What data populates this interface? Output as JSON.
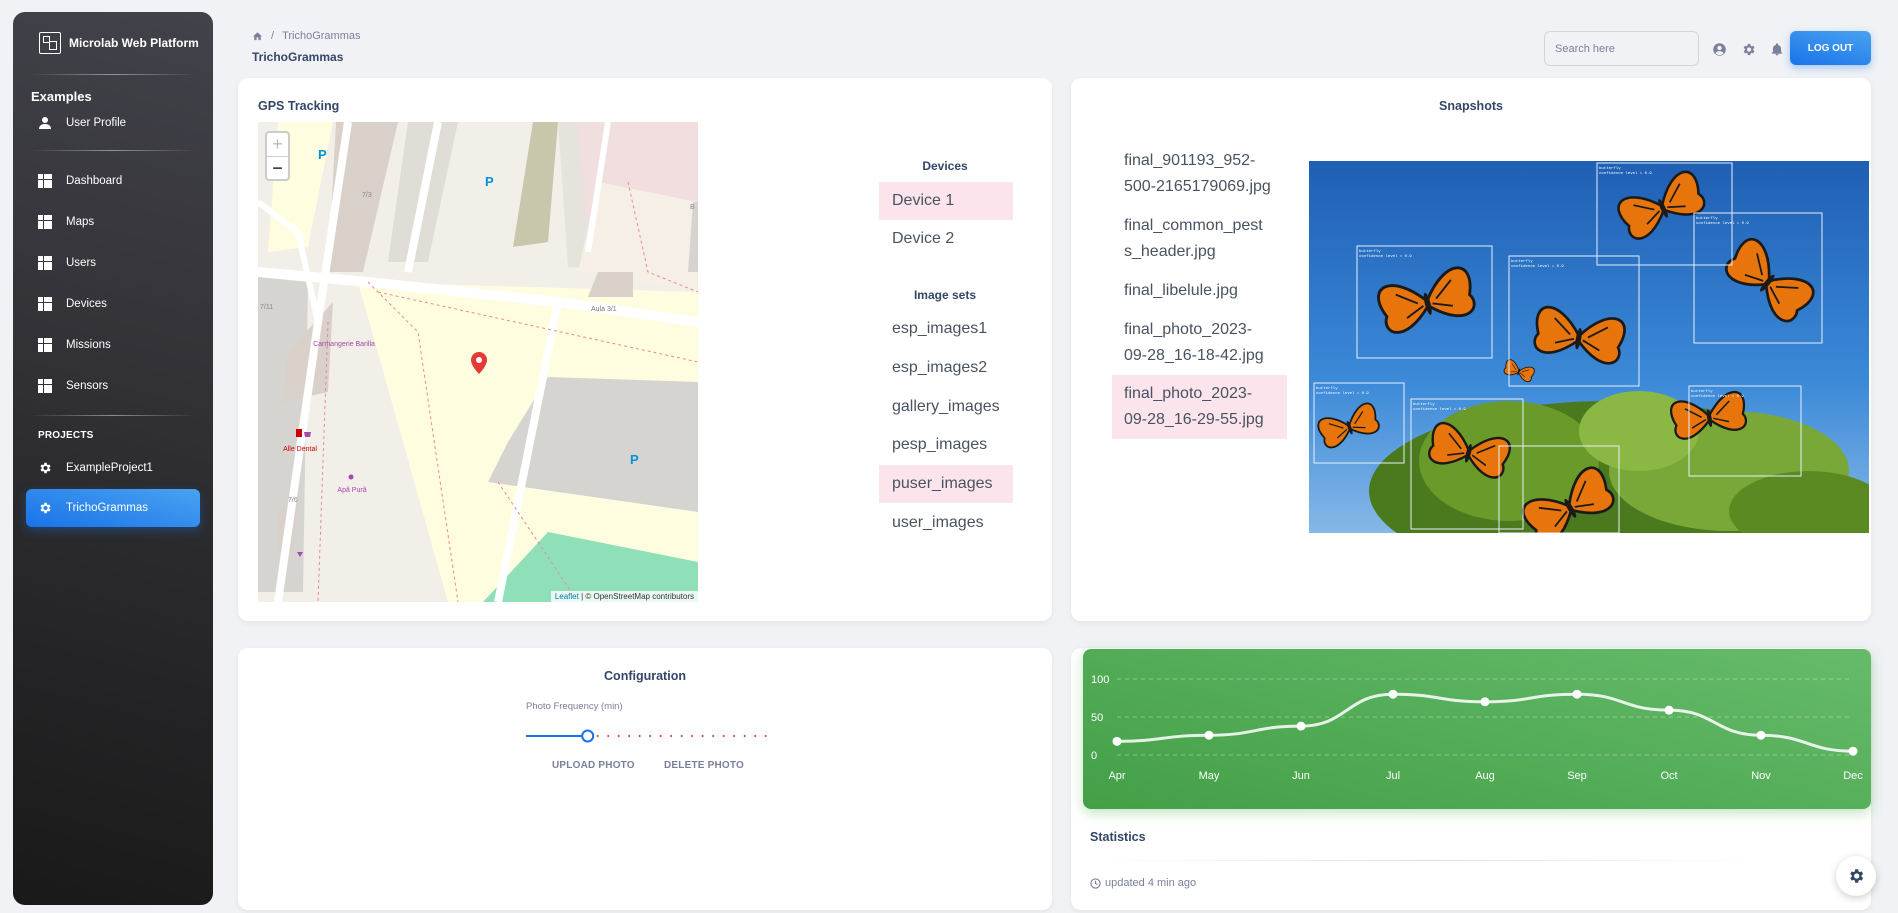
{
  "sidebar": {
    "brand": "Microlab Web Platform",
    "section_examples": "Examples",
    "user_profile": "User Profile",
    "nav": [
      {
        "label": "Dashboard"
      },
      {
        "label": "Maps"
      },
      {
        "label": "Users"
      },
      {
        "label": "Devices"
      },
      {
        "label": "Missions"
      },
      {
        "label": "Sensors"
      }
    ],
    "projects_heading": "PROJECTS",
    "projects": [
      {
        "label": "ExampleProject1",
        "active": false
      },
      {
        "label": "TrichoGrammas",
        "active": true
      }
    ]
  },
  "header": {
    "breadcrumb_current": "TrichoGrammas",
    "title": "TrichoGrammas",
    "search_placeholder": "Search here",
    "logout_label": "LOG OUT"
  },
  "gps": {
    "title": "GPS Tracking",
    "map_labels": {
      "p1": "P",
      "p2": "P",
      "p3": "P",
      "n73": "7/3",
      "n711": "7/11",
      "n76": "7/6",
      "b": "B",
      "aula": "Aula 3/1",
      "carmangerie": "Carmangerie Barilla",
      "dental": "Alle Dental",
      "apa": "Apă Pură"
    },
    "attribution_leaflet": "Leaflet",
    "attribution_rest": " | © OpenStreetMap contributors",
    "devices_heading": "Devices",
    "devices": [
      {
        "label": "Device 1",
        "selected": true
      },
      {
        "label": "Device 2",
        "selected": false
      }
    ],
    "image_sets_heading": "Image sets",
    "image_sets": [
      {
        "label": "esp_images1",
        "selected": false
      },
      {
        "label": "esp_images2",
        "selected": false
      },
      {
        "label": "gallery_images",
        "selected": false
      },
      {
        "label": "pesp_images",
        "selected": false
      },
      {
        "label": "puser_images",
        "selected": true
      },
      {
        "label": "user_images",
        "selected": false
      }
    ]
  },
  "snapshots": {
    "title": "Snapshots",
    "files": [
      {
        "line1": "final_901193_952-",
        "line2": "500-2165179069.jpg",
        "selected": false
      },
      {
        "line1": "final_common_pest",
        "line2": "s_header.jpg",
        "selected": false
      },
      {
        "line1": "final_libelule.jpg",
        "line2": "",
        "selected": false
      },
      {
        "line1": "final_photo_2023-",
        "line2": "09-28_16-18-42.jpg",
        "selected": false
      },
      {
        "line1": "final_photo_2023-",
        "line2": "09-28_16-29-55.jpg",
        "selected": true
      }
    ],
    "detection_label": "butterfly",
    "detection_conf": "confidence level = 0.9"
  },
  "config": {
    "title": "Configuration",
    "slider_label": "Photo Frequency (min)",
    "slider_value_fraction": 0.24,
    "upload_label": "UPLOAD PHOTO",
    "delete_label": "DELETE PHOTO"
  },
  "statistics": {
    "title": "Statistics",
    "updated": "updated 4 min ago",
    "accent": "#4CAF50"
  },
  "chart_data": {
    "type": "line",
    "categories": [
      "Apr",
      "May",
      "Jun",
      "Jul",
      "Aug",
      "Sep",
      "Oct",
      "Nov",
      "Dec"
    ],
    "values": [
      18,
      26,
      38,
      80,
      70,
      80,
      59,
      26,
      5
    ],
    "ylim": [
      0,
      100
    ],
    "yticks": [
      0,
      50,
      100
    ],
    "title": "",
    "xlabel": "",
    "ylabel": ""
  }
}
